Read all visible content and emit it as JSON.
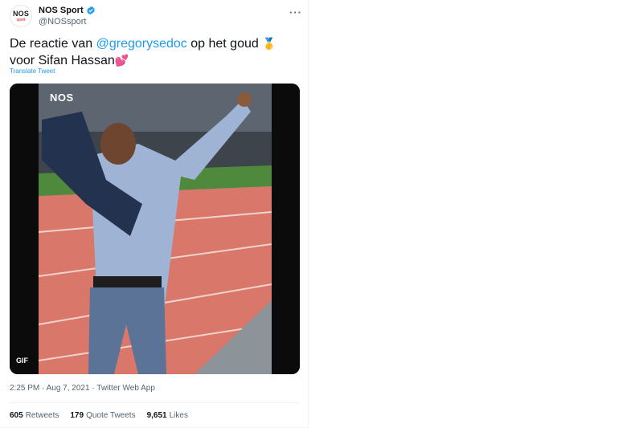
{
  "account": {
    "display_name": "NOS Sport",
    "handle": "@NOSsport",
    "avatar_logo": "NOS",
    "avatar_sub": "sport"
  },
  "tweet": {
    "text_before": "De reactie van ",
    "mention": "@gregorysedoc",
    "text_middle": " op het goud ",
    "medal_emoji": "🥇",
    "text_after": " voor Sifan Hassan",
    "heart_emoji": "💕",
    "translate_label": "Translate Tweet"
  },
  "media": {
    "overlay_logo": "NOS",
    "badge": "GIF",
    "icon": "gif-media"
  },
  "meta": {
    "time": "2:25 PM",
    "date": "Aug 7, 2021",
    "source": "Twitter Web App",
    "separator": "·"
  },
  "stats": {
    "retweets_count": "605",
    "retweets_label": "Retweets",
    "quotes_count": "179",
    "quotes_label": "Quote Tweets",
    "likes_count": "9,651",
    "likes_label": "Likes"
  },
  "colors": {
    "accent": "#1d9bf0",
    "muted": "#536471",
    "track": "#d9776a",
    "field": "#4f8a3c"
  },
  "icons": [
    "verified-badge-icon",
    "more-options-icon",
    "medal-icon",
    "heart-icon"
  ]
}
